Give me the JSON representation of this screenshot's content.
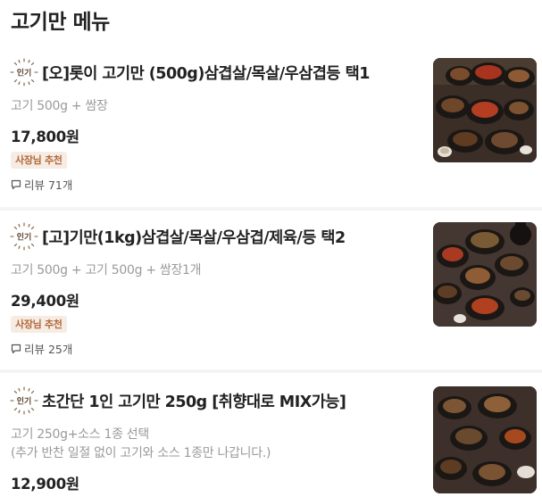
{
  "section": {
    "title": "고기만 메뉴"
  },
  "badges": {
    "popular": "인기"
  },
  "items": [
    {
      "name": "[오]롯이 고기만 (500g)삼겹살/목살/우삼겹등 택1",
      "desc": [
        "고기 500g + 쌈장"
      ],
      "price": "17,800원",
      "owner_badge": "사장님 추천",
      "review": "리뷰 71개",
      "image_icon": "grilled-meat-platter-photo"
    },
    {
      "name": "[고]기만(1kg)삼겹살/목살/우삼겹/제육/등 택2",
      "desc": [
        "고기 500g + 고기 500g + 쌈장1개"
      ],
      "price": "29,400원",
      "owner_badge": "사장님 추천",
      "review": "리뷰 25개",
      "image_icon": "grilled-meat-platter-photo"
    },
    {
      "name": "초간단 1인 고기만 250g [취향대로 MIX가능]",
      "desc": [
        "고기 250g+소스 1종 선택",
        "(추가 반찬 일절 없이 고기와 소스 1종만 나갑니다.)"
      ],
      "price": "12,900원",
      "image_icon": "grilled-meat-platter-photo"
    }
  ],
  "colors": {
    "popular_badge": "#7a5a3a",
    "owner_badge_bg": "#f6ece3",
    "owner_badge_text": "#b2693b"
  }
}
